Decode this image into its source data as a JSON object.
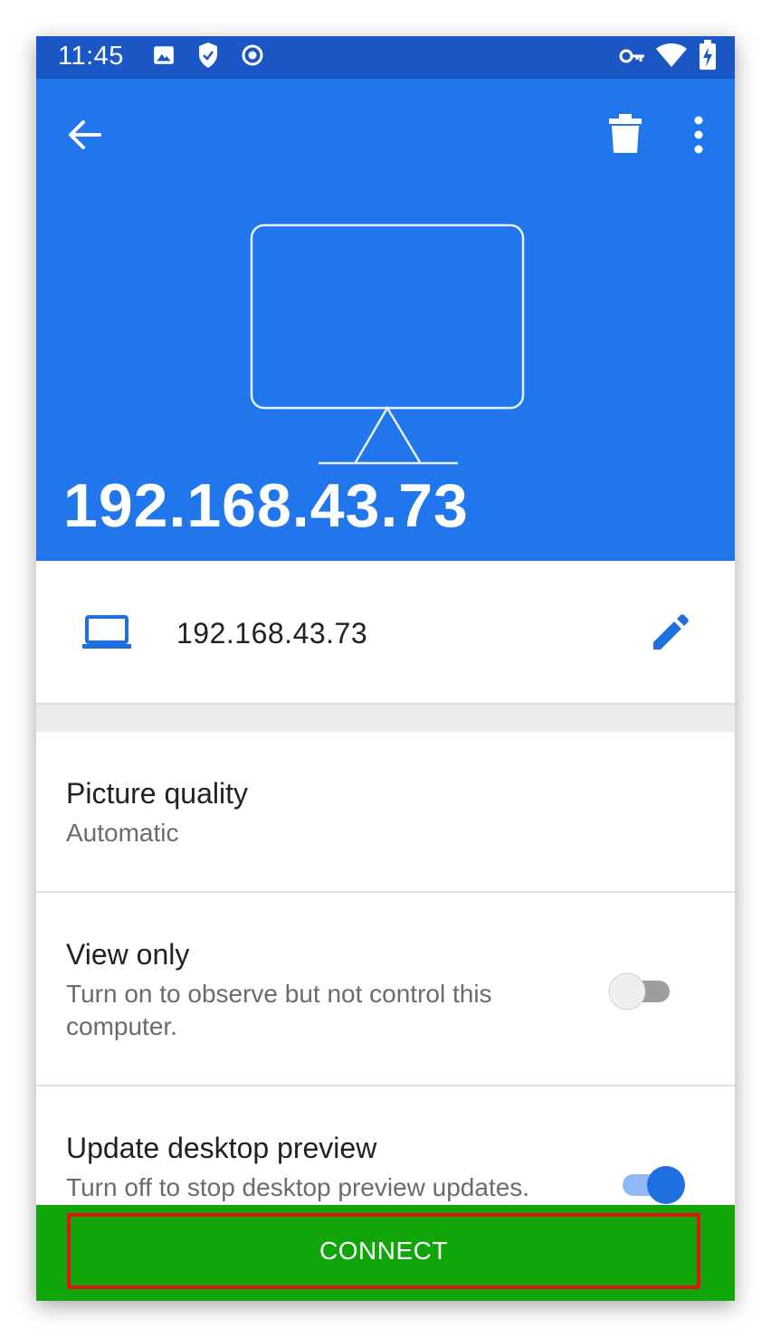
{
  "status_bar": {
    "time": "11:45"
  },
  "header": {
    "device_title": "192.168.43.73"
  },
  "address_card": {
    "address": "192.168.43.73"
  },
  "settings": {
    "picture_quality": {
      "title": "Picture quality",
      "value": "Automatic"
    },
    "view_only": {
      "title": "View only",
      "description": "Turn on to observe but not control this computer.",
      "enabled": false
    },
    "update_preview": {
      "title": "Update desktop preview",
      "description": "Turn off to stop desktop preview updates.",
      "enabled": true
    }
  },
  "footer": {
    "connect_label": "CONNECT"
  },
  "colors": {
    "header_blue": "#2176ec",
    "status_blue": "#1a56c4",
    "accent_blue": "#1f6fe0",
    "connect_green": "#12a50a",
    "highlight_red": "#e01515"
  },
  "icons": [
    "back-arrow-icon",
    "trash-icon",
    "more-vert-icon",
    "monitor-icon",
    "laptop-icon",
    "edit-pencil-icon",
    "image-icon",
    "shield-icon",
    "record-icon",
    "vpn-key-icon",
    "wifi-icon",
    "battery-charging-icon"
  ]
}
